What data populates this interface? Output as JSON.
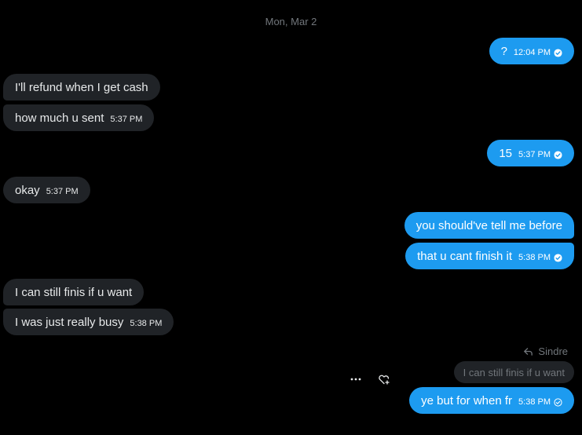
{
  "date_separator": "Mon, Mar 2",
  "messages": [
    {
      "direction": "outgoing",
      "text": "?",
      "time": "12:04 PM",
      "status_icon": "check-circle-filled"
    },
    {
      "direction": "incoming",
      "text": "I'll refund when I get cash",
      "time": ""
    },
    {
      "direction": "incoming",
      "text": "how much u sent",
      "time": "5:37 PM"
    },
    {
      "direction": "outgoing",
      "text": "15",
      "time": "5:37 PM",
      "status_icon": "check-circle-filled"
    },
    {
      "direction": "incoming",
      "text": "okay",
      "time": "5:37 PM"
    },
    {
      "direction": "outgoing",
      "text": "you should've tell me before",
      "time": ""
    },
    {
      "direction": "outgoing",
      "text": "that u cant finish it",
      "time": "5:38 PM",
      "status_icon": "check-circle-filled"
    },
    {
      "direction": "incoming",
      "text": "I can still finis if u want",
      "time": ""
    },
    {
      "direction": "incoming",
      "text": "I was just really busy",
      "time": "5:38 PM"
    },
    {
      "direction": "outgoing",
      "text": "ye but for when fr",
      "time": "5:38 PM",
      "status_icon": "check-circle-outline"
    }
  ],
  "reply": {
    "label": "Sindre",
    "quoted_text": "I can still finis if u want"
  },
  "actions": {
    "more_icon": "more-horizontal-icon",
    "react_icon": "heart-plus-icon"
  },
  "colors": {
    "background": "#000000",
    "incoming_bubble": "#202327",
    "outgoing_bubble": "#1d9bf0",
    "muted_text": "#71767b"
  }
}
